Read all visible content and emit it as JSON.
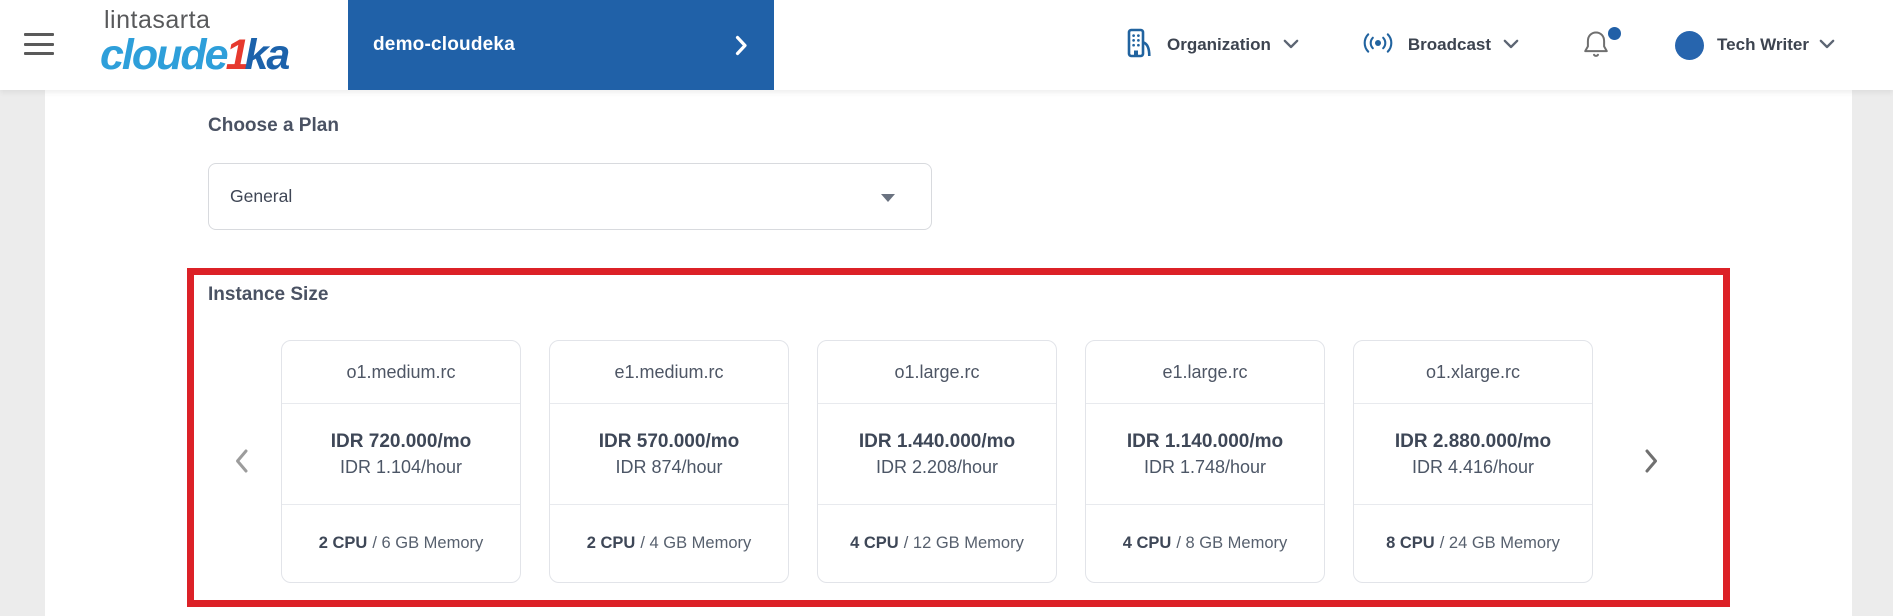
{
  "header": {
    "logo": {
      "top": "lintasarta",
      "main_light": "cloude",
      "main_accent": "1",
      "main_dark": "ka"
    },
    "project_banner": {
      "label": "demo-cloudeka"
    },
    "nav": [
      {
        "label": "Organization",
        "icon": "building-icon"
      },
      {
        "label": "Broadcast",
        "icon": "broadcast-icon"
      }
    ],
    "notifications": {
      "icon": "bell-icon",
      "has_unread": true
    },
    "user": {
      "name": "Tech Writer"
    }
  },
  "plan": {
    "label": "Choose a Plan",
    "selected": "General"
  },
  "instance_size": {
    "title": "Instance Size",
    "cards": [
      {
        "name": "o1.medium.rc",
        "monthly": "IDR 720.000/mo",
        "hourly": "IDR 1.104/hour",
        "cpu": "2 CPU",
        "memory": "/ 6 GB Memory"
      },
      {
        "name": "e1.medium.rc",
        "monthly": "IDR 570.000/mo",
        "hourly": "IDR 874/hour",
        "cpu": "2 CPU",
        "memory": "/ 4 GB Memory"
      },
      {
        "name": "o1.large.rc",
        "monthly": "IDR 1.440.000/mo",
        "hourly": "IDR 2.208/hour",
        "cpu": "4 CPU",
        "memory": "/ 12 GB Memory"
      },
      {
        "name": "e1.large.rc",
        "monthly": "IDR 1.140.000/mo",
        "hourly": "IDR 1.748/hour",
        "cpu": "4 CPU",
        "memory": "/ 8 GB Memory"
      },
      {
        "name": "o1.xlarge.rc",
        "monthly": "IDR 2.880.000/mo",
        "hourly": "IDR 4.416/hour",
        "cpu": "8 CPU",
        "memory": "/ 24 GB Memory"
      }
    ]
  },
  "colors": {
    "banner-blue": "#2061a8",
    "logo-light-blue": "#2e9fda",
    "logo-dark-blue": "#1c62ab",
    "logo-red": "#e6392e",
    "icon-blue": "#21639f",
    "accent-red": "#dc2127",
    "avatar-blue": "#2765ae",
    "notification-dot": "#2160a7"
  }
}
